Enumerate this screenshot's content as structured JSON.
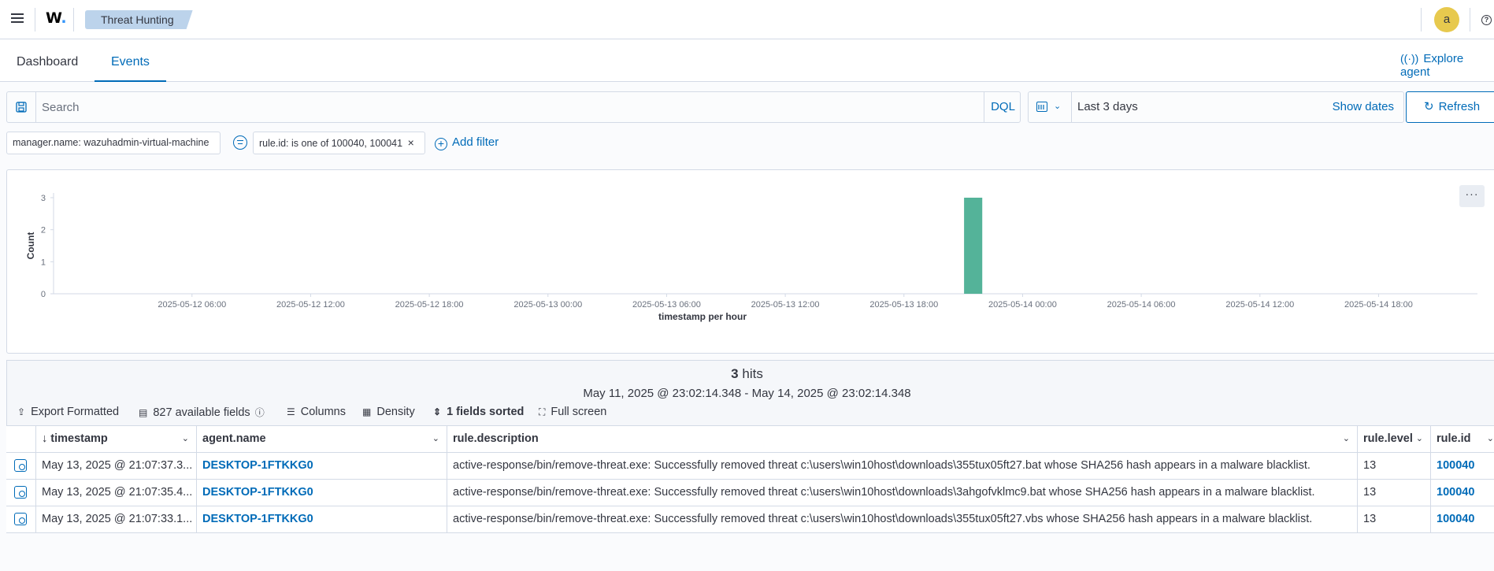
{
  "header": {
    "logo": "W",
    "logo_dot": ".",
    "breadcrumb": "Threat Hunting",
    "avatar_initial": "a",
    "help": "?"
  },
  "tabs": [
    {
      "label": "Dashboard",
      "active": false
    },
    {
      "label": "Events",
      "active": true
    }
  ],
  "explore_agent_label": "Explore agent",
  "query": {
    "placeholder": "Search",
    "language": "DQL"
  },
  "time": {
    "range": "Last 3 days",
    "show_dates": "Show dates",
    "refresh": "Refresh"
  },
  "filters": [
    {
      "label": "manager.name: wazuhadmin-virtual-machine"
    },
    {
      "label": "rule.id: is one of 100040, 100041",
      "remove": "×"
    }
  ],
  "add_filter_label": "Add filter",
  "chart_data": {
    "type": "bar",
    "ylabel": "Count",
    "xlabel": "timestamp per hour",
    "ylim": [
      0,
      3
    ],
    "yticks": [
      "0",
      "1",
      "2",
      "3"
    ],
    "xticks": [
      "2025-05-12 06:00",
      "2025-05-12 12:00",
      "2025-05-12 18:00",
      "2025-05-13 00:00",
      "2025-05-13 06:00",
      "2025-05-13 12:00",
      "2025-05-13 18:00",
      "2025-05-14 00:00",
      "2025-05-14 06:00",
      "2025-05-14 12:00",
      "2025-05-14 18:00"
    ],
    "x_start": "2025-05-11 23:00",
    "x_end": "2025-05-14 23:00",
    "series": [
      {
        "x": [
          "2025-05-13 21:00"
        ],
        "values": [
          3
        ]
      }
    ],
    "bar_color": "#54b399",
    "grid": false
  },
  "results": {
    "hits_count": "3",
    "hits_label": "hits",
    "range": "May 11, 2025 @ 23:02:14.348 - May 14, 2025 @ 23:02:14.348",
    "toolbar": {
      "export": "Export Formatted",
      "fields": "827 available fields",
      "columns": "Columns",
      "density": "Density",
      "sorted": "1 fields sorted",
      "fullscreen": "Full screen"
    },
    "columns": [
      "timestamp",
      "agent.name",
      "rule.description",
      "rule.level",
      "rule.id"
    ],
    "rows": [
      {
        "timestamp": "May 13, 2025 @ 21:07:37.3...",
        "agent": "DESKTOP-1FTKKG0",
        "description": "active-response/bin/remove-threat.exe: Successfully removed threat c:\\users\\win10host\\downloads\\355tux05ft27.bat whose SHA256 hash appears in a malware blacklist.",
        "level": "13",
        "rule_id": "100040"
      },
      {
        "timestamp": "May 13, 2025 @ 21:07:35.4...",
        "agent": "DESKTOP-1FTKKG0",
        "description": "active-response/bin/remove-threat.exe: Successfully removed threat c:\\users\\win10host\\downloads\\3ahgofvklmc9.bat whose SHA256 hash appears in a malware blacklist.",
        "level": "13",
        "rule_id": "100040"
      },
      {
        "timestamp": "May 13, 2025 @ 21:07:33.1...",
        "agent": "DESKTOP-1FTKKG0",
        "description": "active-response/bin/remove-threat.exe: Successfully removed threat c:\\users\\win10host\\downloads\\355tux05ft27.vbs whose SHA256 hash appears in a malware blacklist.",
        "level": "13",
        "rule_id": "100040"
      }
    ]
  }
}
